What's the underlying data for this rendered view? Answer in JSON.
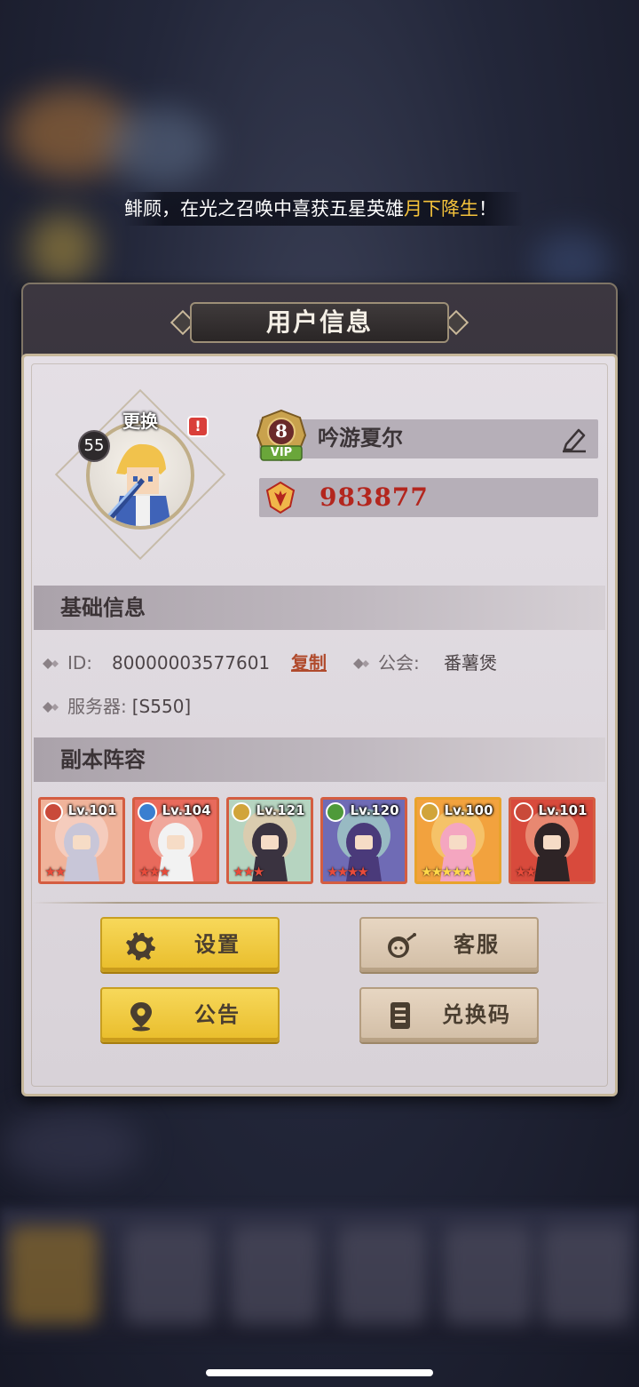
{
  "marquee": {
    "text_before": "鲱顾，在光之召唤中喜获五星英雄",
    "highlight": "月下降生",
    "text_after": "！"
  },
  "panel": {
    "title": "用户信息"
  },
  "profile": {
    "avatar_change_label": "更换",
    "alert_badge": "!",
    "level": "55",
    "vip_level": "8",
    "vip_label": "VIP",
    "name": "吟游夏尔",
    "power": "983877"
  },
  "basic_info": {
    "header": "基础信息",
    "id_label": "ID:",
    "id_value": "80000003577601",
    "copy_label": "复制",
    "guild_label": "公会:",
    "guild_value": "番薯煲",
    "server_label": "服务器:",
    "server_value": "[S550]"
  },
  "lineup": {
    "header": "副本阵容",
    "heroes": [
      {
        "level": "Lv.101",
        "stars": 2,
        "element": "fire",
        "element_color": "#c94a3a"
      },
      {
        "level": "Lv.104",
        "stars": 3,
        "element": "water",
        "element_color": "#3a7fd0"
      },
      {
        "level": "Lv.121",
        "stars": 3,
        "element": "light",
        "element_color": "#d1a43a"
      },
      {
        "level": "Lv.120",
        "stars": 4,
        "element": "nature",
        "element_color": "#4e9a3a"
      },
      {
        "level": "Lv.100",
        "stars": 5,
        "element": "light",
        "element_color": "#d1a43a"
      },
      {
        "level": "Lv.101",
        "stars": 2,
        "element": "fire",
        "element_color": "#c94a3a"
      }
    ]
  },
  "buttons": {
    "settings": "设置",
    "support": "客服",
    "notice": "公告",
    "redeem": "兑换码"
  },
  "colors": {
    "accent_yellow": "#f2cc48",
    "power_red": "#b3261e",
    "hero_border": "#d45d41",
    "highlight_gold": "#f5c33b"
  }
}
